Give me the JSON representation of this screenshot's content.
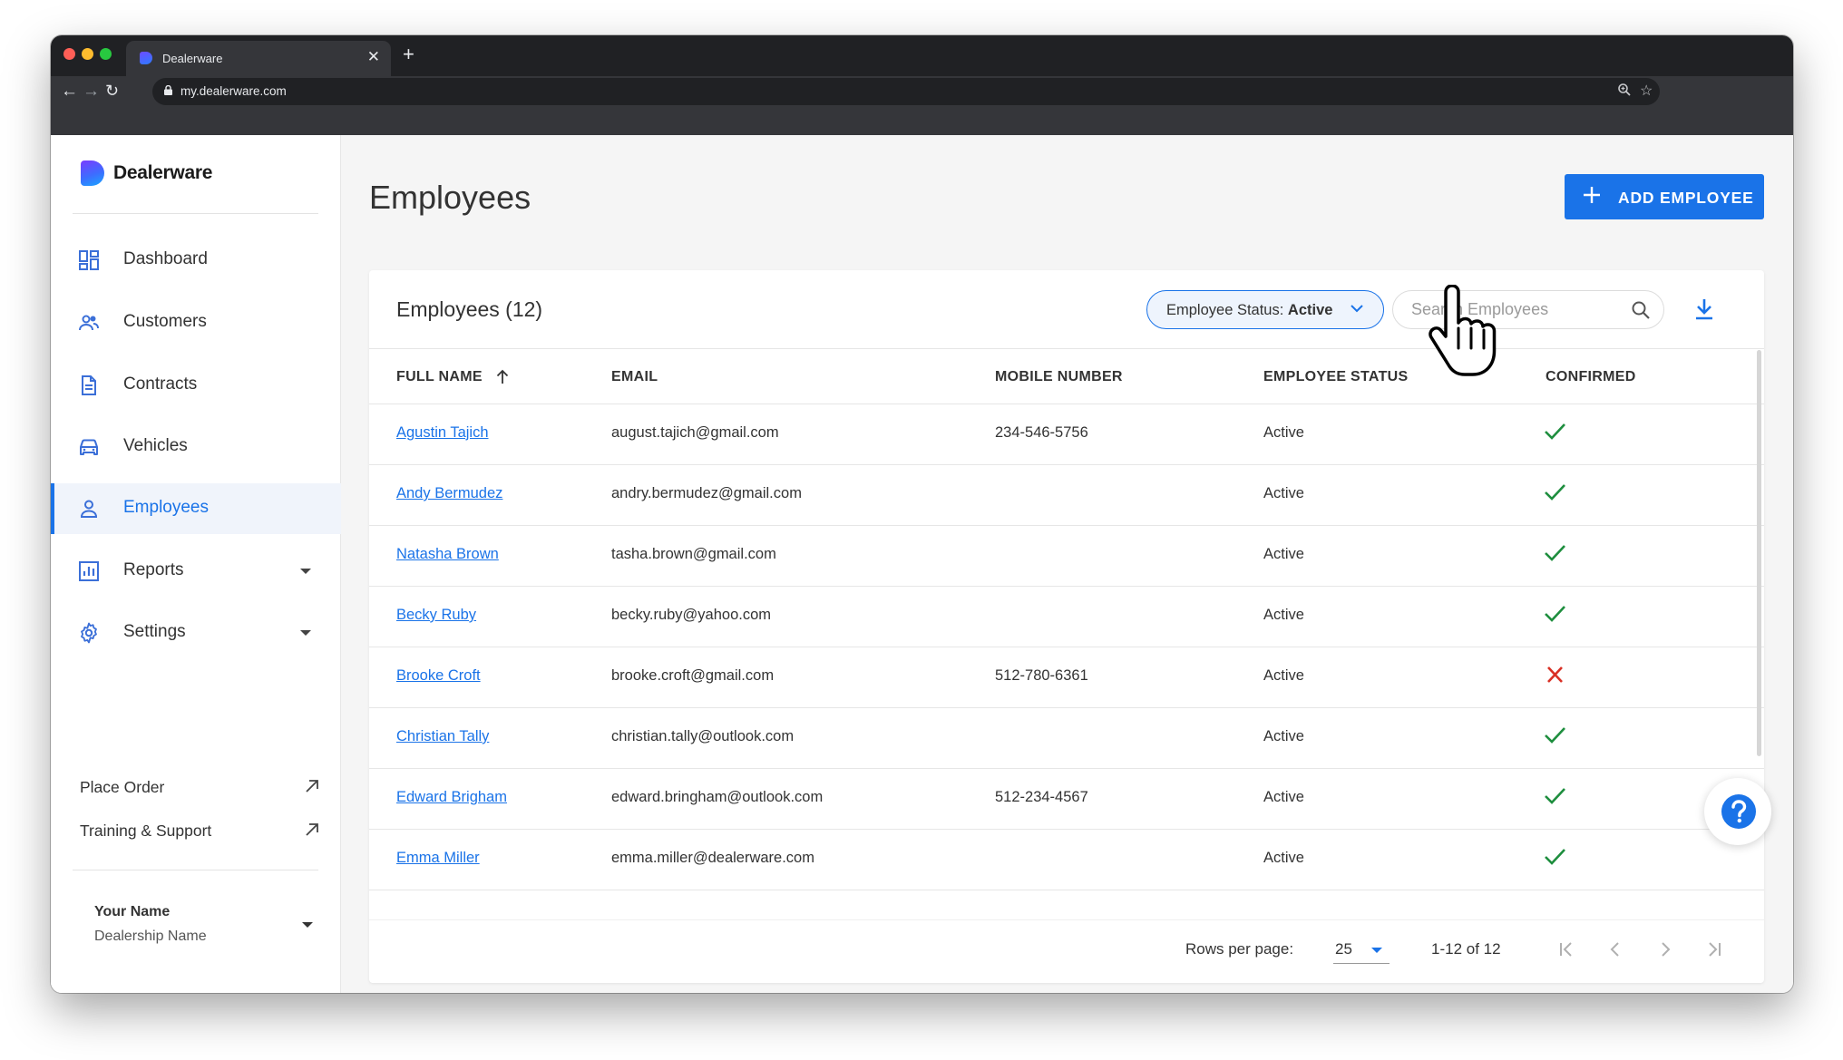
{
  "browser": {
    "tab_title": "Dealerware",
    "url": "my.dealerware.com"
  },
  "sidebar": {
    "brand": "Dealerware",
    "items": [
      {
        "label": "Dashboard",
        "icon": "dashboard-icon"
      },
      {
        "label": "Customers",
        "icon": "customers-icon"
      },
      {
        "label": "Contracts",
        "icon": "document-icon"
      },
      {
        "label": "Vehicles",
        "icon": "car-icon"
      },
      {
        "label": "Employees",
        "icon": "person-icon",
        "active": true
      },
      {
        "label": "Reports",
        "icon": "bar-chart-icon",
        "expandable": true
      },
      {
        "label": "Settings",
        "icon": "gear-icon",
        "expandable": true
      }
    ],
    "links": [
      {
        "label": "Place Order",
        "icon": "external-arrow-icon"
      },
      {
        "label": "Training & Support",
        "icon": "external-arrow-icon"
      }
    ],
    "user": {
      "name": "Your Name",
      "dealership": "Dealership Name"
    }
  },
  "page": {
    "title": "Employees",
    "add_button": "ADD EMPLOYEE"
  },
  "card": {
    "title": "Employees (12)",
    "filter": {
      "prefix": "Employee Status: ",
      "value": "Active"
    },
    "search": {
      "placeholder": "Search Employees",
      "value": ""
    }
  },
  "table": {
    "columns": [
      "FULL NAME",
      "EMAIL",
      "MOBILE NUMBER",
      "EMPLOYEE STATUS",
      "CONFIRMED"
    ],
    "sort": {
      "column": "FULL NAME",
      "direction": "ascending"
    },
    "rows": [
      {
        "name": "Agustin Tajich",
        "email": "august.tajich@gmail.com",
        "mobile": "234-546-5756",
        "status": "Active",
        "confirmed": true
      },
      {
        "name": "Andy Bermudez",
        "email": "andry.bermudez@gmail.com",
        "mobile": "",
        "status": "Active",
        "confirmed": true
      },
      {
        "name": "Natasha Brown",
        "email": "tasha.brown@gmail.com",
        "mobile": "",
        "status": "Active",
        "confirmed": true
      },
      {
        "name": "Becky Ruby",
        "email": "becky.ruby@yahoo.com",
        "mobile": "",
        "status": "Active",
        "confirmed": true
      },
      {
        "name": "Brooke Croft",
        "email": "brooke.croft@gmail.com",
        "mobile": "512-780-6361",
        "status": "Active",
        "confirmed": false
      },
      {
        "name": "Christian Tally",
        "email": "christian.tally@outlook.com",
        "mobile": "",
        "status": "Active",
        "confirmed": true
      },
      {
        "name": "Edward Brigham",
        "email": "edward.bringham@outlook.com",
        "mobile": "512-234-4567",
        "status": "Active",
        "confirmed": true
      },
      {
        "name": "Emma Miller",
        "email": "emma.miller@dealerware.com",
        "mobile": "",
        "status": "Active",
        "confirmed": true
      }
    ]
  },
  "pagination": {
    "rows_per_page_label": "Rows per page:",
    "rows_per_page": "25",
    "range": "1-12 of 12"
  },
  "colors": {
    "accent": "#1a73e8",
    "confirmed_yes": "#1e8e3e",
    "confirmed_no": "#d93025"
  }
}
